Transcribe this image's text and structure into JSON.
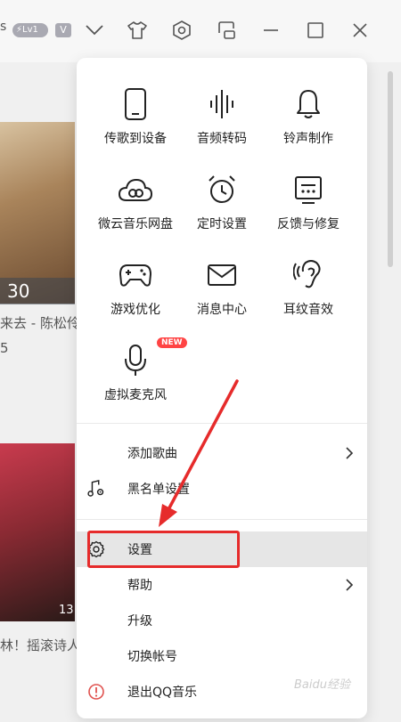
{
  "topbar": {
    "partial_text": "s",
    "level_badge": "Lv1",
    "vip_badge": "V",
    "icons": [
      "chevron-down-icon",
      "tshirt-skin-icon",
      "settings-hex-icon",
      "mini-mode-icon",
      "minimize-icon",
      "maximize-icon",
      "close-icon"
    ]
  },
  "background": {
    "art1_count": "30",
    "song1_text": "来去 - 陈松伶",
    "song1_line2": "5",
    "art2_count": "13",
    "song2_text": "林！摇滚诗人"
  },
  "menu": {
    "grid": [
      {
        "label": "传歌到设备",
        "icon": "phone-device-icon"
      },
      {
        "label": "音频转码",
        "icon": "audio-waveform-icon"
      },
      {
        "label": "铃声制作",
        "icon": "bell-icon"
      },
      {
        "label": "微云音乐网盘",
        "icon": "cloud-drive-icon"
      },
      {
        "label": "定时设置",
        "icon": "alarm-clock-icon"
      },
      {
        "label": "反馈与修复",
        "icon": "feedback-icon"
      },
      {
        "label": "游戏优化",
        "icon": "gamepad-icon"
      },
      {
        "label": "消息中心",
        "icon": "mail-icon"
      },
      {
        "label": "耳纹音效",
        "icon": "ear-icon"
      },
      {
        "label": "虚拟麦克风",
        "icon": "microphone-icon",
        "badge": "NEW"
      }
    ],
    "items": [
      {
        "label": "添加歌曲",
        "icon": "",
        "has_submenu": true
      },
      {
        "label": "黑名单设置",
        "icon": "music-note-gear-icon",
        "has_submenu": false
      },
      {
        "label": "设置",
        "icon": "gear-icon",
        "has_submenu": false,
        "highlighted": true
      },
      {
        "label": "帮助",
        "icon": "",
        "has_submenu": true
      },
      {
        "label": "升级",
        "icon": "",
        "has_submenu": false
      },
      {
        "label": "切换帐号",
        "icon": "",
        "has_submenu": false
      },
      {
        "label": "退出QQ音乐",
        "icon": "exit-alert-icon",
        "has_submenu": false
      }
    ]
  },
  "annotation": {
    "color": "#e62b2b"
  },
  "watermark": "Baidu经验"
}
